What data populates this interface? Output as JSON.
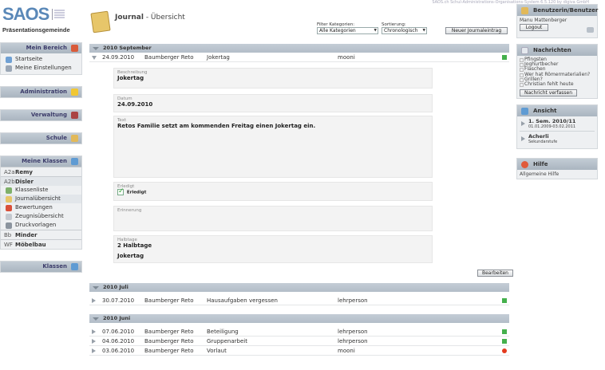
{
  "top_caption": "SAOS.ch Schul-Administrations-Organisations-System 6.5.120 by digiva GmbH",
  "logo": {
    "text": "SAOS",
    "subtitle": "Präsentationsgemeinde"
  },
  "left": {
    "mein_bereich": {
      "title": "Mein Bereich",
      "items": [
        "Startseite",
        "Meine Einstellungen"
      ]
    },
    "administration": {
      "title": "Administration"
    },
    "verwaltung": {
      "title": "Verwaltung"
    },
    "schule": {
      "title": "Schule"
    },
    "meine_klassen": {
      "title": "Meine Klassen",
      "classes": [
        {
          "code": "A2a",
          "name": "Remy"
        },
        {
          "code": "A2b",
          "name": "Disler"
        }
      ],
      "items": [
        "Klassenliste",
        "Journalübersicht",
        "Bewertungen",
        "Zeugnisübersicht",
        "Druckvorlagen"
      ],
      "classes2": [
        {
          "code": "Bb",
          "name": "Minder"
        },
        {
          "code": "WF",
          "name": "Möbelbau"
        }
      ]
    },
    "klassen": {
      "title": "Klassen"
    }
  },
  "header": {
    "title_strong": "Journal",
    "title_rest": " - Übersicht",
    "filter_label": "Filter Kategorien:",
    "filter_value": "Alle Kategorien",
    "sort_label": "Sortierung:",
    "sort_value": "Chronologisch",
    "new_button": "Neuer Journaleintrag"
  },
  "sections": {
    "sep": "2010 September",
    "jul": "2010 Juli",
    "jun": "2010 Juni"
  },
  "entries": {
    "e1": {
      "date": "24.09.2010",
      "author": "Baumberger Reto",
      "category": "Jokertag",
      "user": "mooni"
    },
    "e2": {
      "date": "30.07.2010",
      "author": "Baumberger Reto",
      "category": "Hausaufgaben vergessen",
      "user": "lehrperson"
    },
    "e3": {
      "date": "07.06.2010",
      "author": "Baumberger Reto",
      "category": "Beteiligung",
      "user": "lehrperson"
    },
    "e4": {
      "date": "04.06.2010",
      "author": "Baumberger Reto",
      "category": "Gruppenarbeit",
      "user": "lehrperson"
    },
    "e5": {
      "date": "03.06.2010",
      "author": "Baumberger Reto",
      "category": "Vorlaut",
      "user": "mooni"
    }
  },
  "detail": {
    "beschreibung_label": "Beschreibung",
    "beschreibung": "Jokertag",
    "datum_label": "Datum",
    "datum": "24.09.2010",
    "text_label": "Text",
    "text": "Retos Familie setzt am kommenden Freitag einen Jokertag ein.",
    "erledigt_label": "Erledigt",
    "erledigt": "Erledigt",
    "erinnerung_label": "Erinnerung",
    "halbtage_label": "Halbtage",
    "halbtage": "2 Halbtage",
    "halbtage_extra": "Jokertag",
    "edit_button": "Bearbeiten"
  },
  "right": {
    "benutzer": {
      "title": "Benutzerin/Benutzer",
      "name": "Manu Mattenberger",
      "logout": "Logout"
    },
    "nachrichten": {
      "title": "Nachrichten",
      "items": [
        "Pfingsten",
        "Joghurtbecher",
        "Flaschen",
        "Wer hat Römermaterialien?",
        "Grillen?",
        "Christian fehlt heute"
      ],
      "button": "Nachricht verfassen"
    },
    "ansicht": {
      "title": "Ansicht",
      "sem": "1. Sem. 2010/11",
      "sem_dates": "01.01.2009-03.02.2011",
      "school": "Acherli",
      "school_level": "Sekundarstufe"
    },
    "hilfe": {
      "title": "Hilfe",
      "link": "Allgemeine Hilfe"
    }
  }
}
